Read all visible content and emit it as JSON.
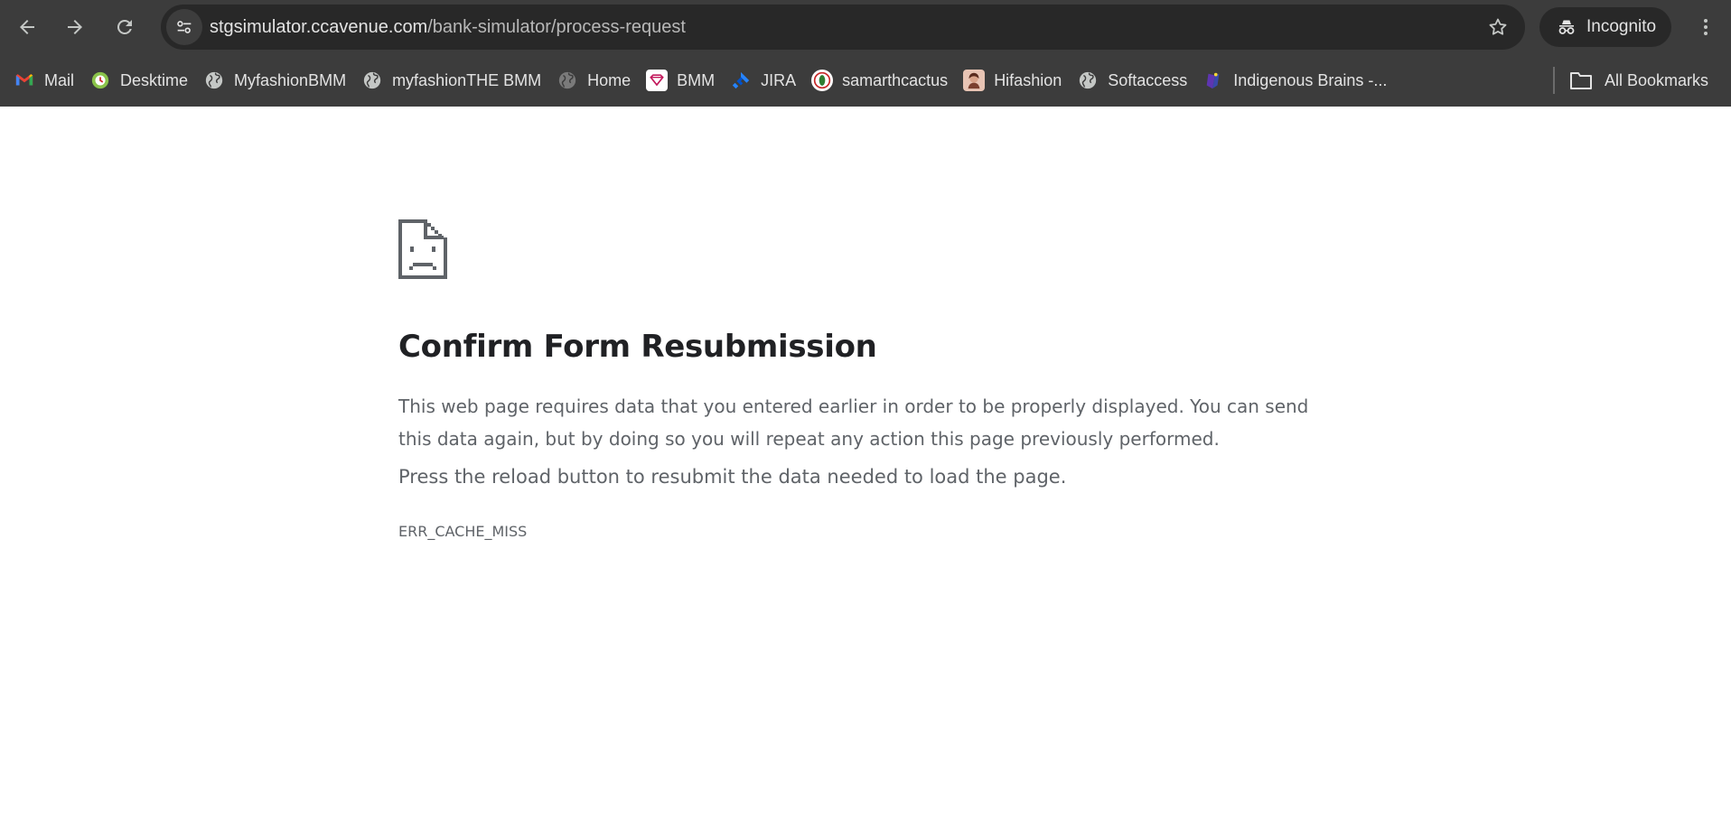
{
  "browser": {
    "url_host": "stgsimulator.ccavenue.com",
    "url_path": "/bank-simulator/process-request",
    "incognito_label": "Incognito",
    "colors": {
      "chrome": "#3c3c3c",
      "omnibox": "#282828",
      "text": "#e3e3e3"
    }
  },
  "bookmarks": {
    "items": [
      {
        "label": "Mail",
        "icon": "gmail-icon"
      },
      {
        "label": "Desktime",
        "icon": "desktime-icon"
      },
      {
        "label": "MyfashionBMM",
        "icon": "globe-icon"
      },
      {
        "label": "myfashionTHE BMM",
        "icon": "globe-icon"
      },
      {
        "label": "Home",
        "icon": "globe-icon"
      },
      {
        "label": "BMM",
        "icon": "bmm-icon"
      },
      {
        "label": "JIRA",
        "icon": "jira-icon"
      },
      {
        "label": "samarthcactus",
        "icon": "samarth-icon"
      },
      {
        "label": "Hifashion",
        "icon": "hifashion-icon"
      },
      {
        "label": "Softaccess",
        "icon": "globe-icon"
      },
      {
        "label": "Indigenous Brains -...",
        "icon": "indigenous-icon"
      }
    ],
    "all_label": "All Bookmarks"
  },
  "error": {
    "title": "Confirm Form Resubmission",
    "description": "This web page requires data that you entered earlier in order to be properly displayed. You can send this data again, but by doing so you will repeat any action this page previously performed.",
    "hint": "Press the reload button to resubmit the data needed to load the page.",
    "code": "ERR_CACHE_MISS"
  }
}
